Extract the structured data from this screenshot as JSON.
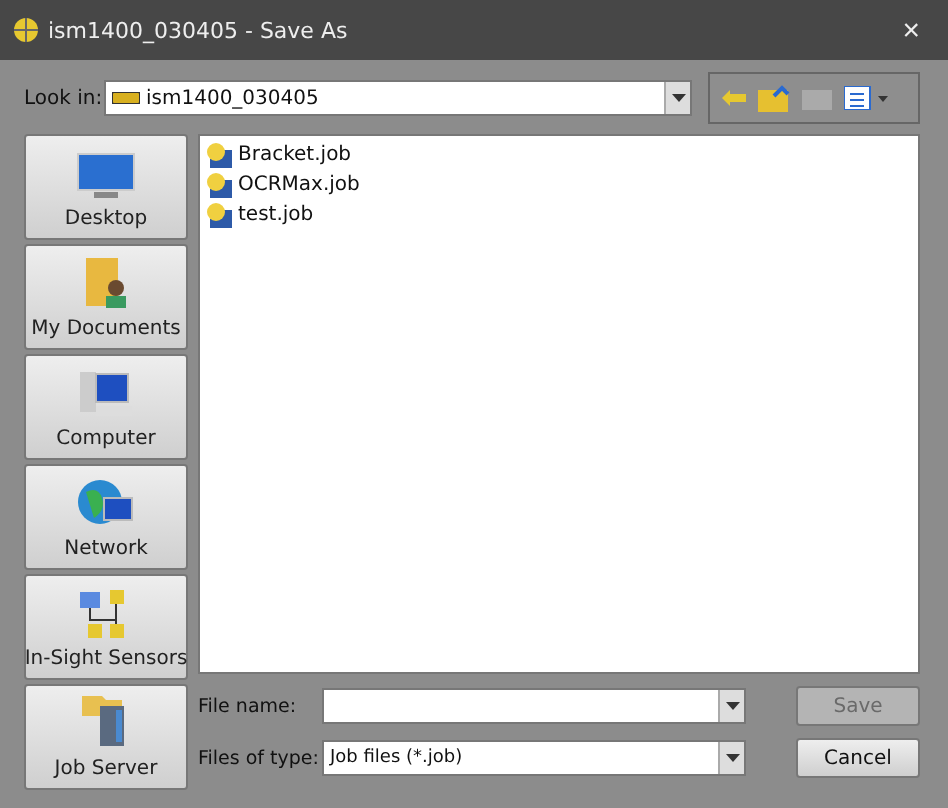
{
  "window": {
    "title": "ism1400_030405 - Save As",
    "close": "×"
  },
  "look_in": {
    "label": "Look in:",
    "value": "ism1400_030405"
  },
  "places": [
    {
      "label": "Desktop",
      "kind": "desktop"
    },
    {
      "label": "My Documents",
      "kind": "documents"
    },
    {
      "label": "Computer",
      "kind": "computer"
    },
    {
      "label": "Network",
      "kind": "network"
    },
    {
      "label": "In-Sight Sensors",
      "kind": "sensors"
    },
    {
      "label": "Job Server",
      "kind": "server"
    }
  ],
  "files": [
    {
      "name": "Bracket.job"
    },
    {
      "name": "OCRMax.job"
    },
    {
      "name": "test.job"
    }
  ],
  "file_name": {
    "label": "File name:"
  },
  "file_type": {
    "label": "Files of type:",
    "value": "Job files (*.job)"
  },
  "buttons": [
    {
      "label": "Save",
      "disabled": true
    },
    {
      "label": "Cancel",
      "disabled": false
    }
  ]
}
